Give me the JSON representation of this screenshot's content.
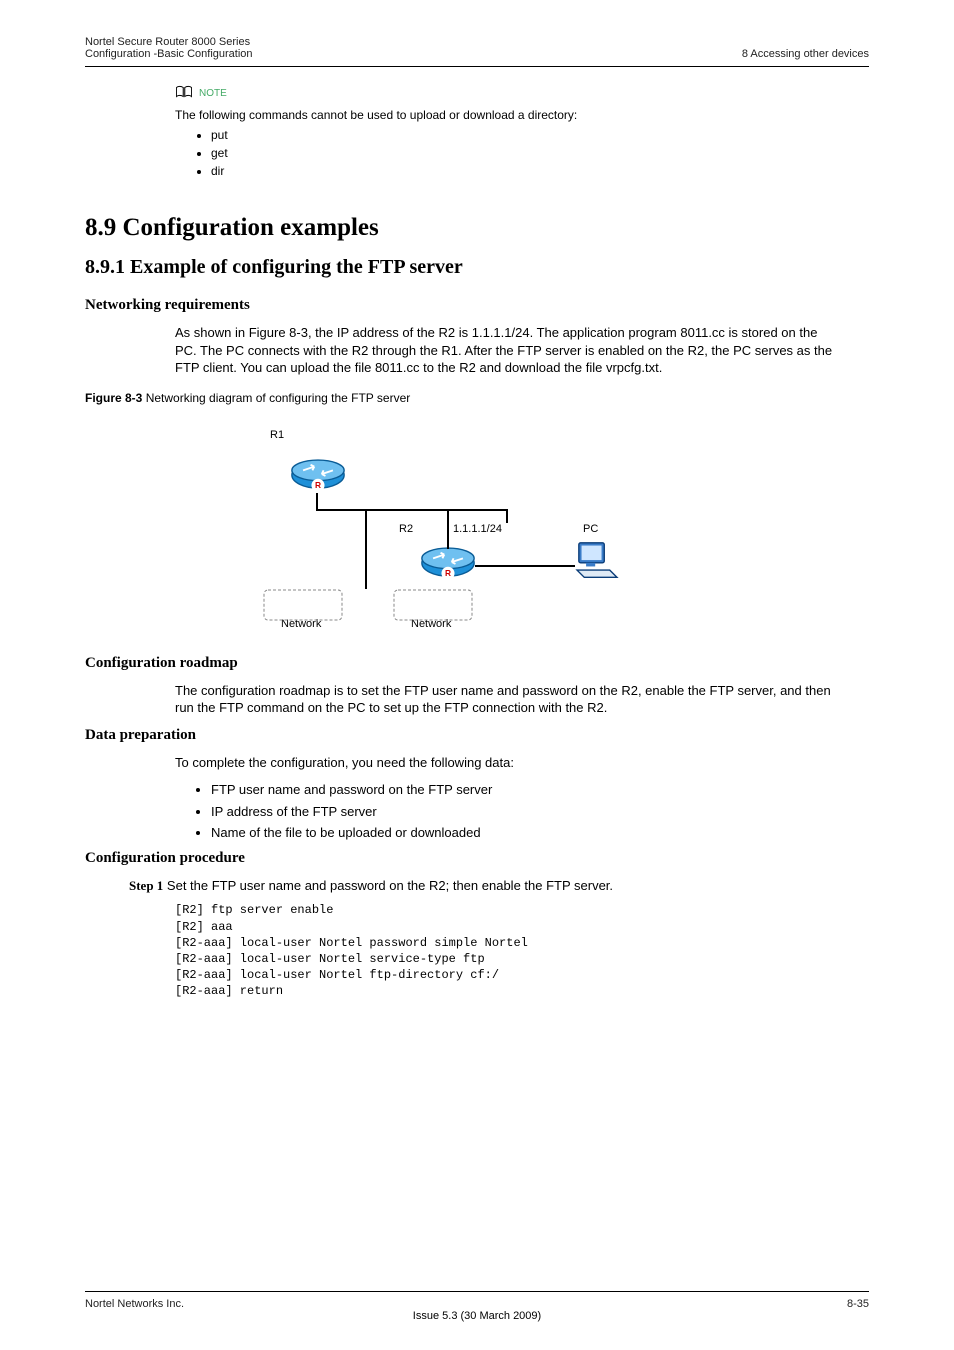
{
  "header": {
    "left1": "Nortel Secure Router 8000 Series",
    "left2": "Configuration -Basic Configuration",
    "right1": "8 Accessing other devices"
  },
  "note": {
    "label": "NOTE",
    "intro": "The following commands cannot be used to upload or download a directory:",
    "items": [
      "put",
      "get",
      "dir"
    ]
  },
  "h1": "8.9 Configuration examples",
  "h2": "8.9.1 Example of configuring the FTP server",
  "sec_networking": {
    "title": "Networking requirements",
    "p": "As shown in Figure 8-3, the IP address of the R2 is 1.1.1.1/24. The application program 8011.cc is stored on the PC. The PC connects with the R2 through the R1. After the FTP server is enabled on the R2, the PC serves as the FTP client. You can upload the file 8011.cc to the R2 and download the file vrpcfg.txt."
  },
  "figure": {
    "caption_bold": "Figure 8-3",
    "caption_rest": " Networking diagram of configuring the FTP server",
    "r1": "R1",
    "r2": "R2",
    "pc": "PC",
    "addr1": "1.1.1.1/24",
    "n1": "Network",
    "n2": "Network"
  },
  "sec_roadmap": {
    "title": "Configuration roadmap",
    "p": "The configuration roadmap is to set the FTP user name and password on the R2, enable the FTP server, and then run the FTP command on the PC to set up the FTP connection with the R2."
  },
  "sec_data": {
    "title": "Data preparation",
    "intro": "To complete the configuration, you need the following data:",
    "items": [
      "FTP user name and password on the FTP server",
      "IP address of the FTP server",
      "Name of the file to be uploaded or downloaded"
    ]
  },
  "sec_proc": {
    "title": "Configuration procedure",
    "step_label": "Step 1",
    "step_text": " Set the FTP user name and password on the R2; then enable the FTP server.",
    "code": "[R2] ftp server enable\n[R2] aaa\n[R2-aaa] local-user Nortel password simple Nortel\n[R2-aaa] local-user Nortel service-type ftp\n[R2-aaa] local-user Nortel ftp-directory cf:/\n[R2-aaa] return"
  },
  "footer": {
    "left1": "Nortel Networks Inc.",
    "right1": "8-35",
    "center1": "Issue 5.3 (30 March 2009)"
  }
}
